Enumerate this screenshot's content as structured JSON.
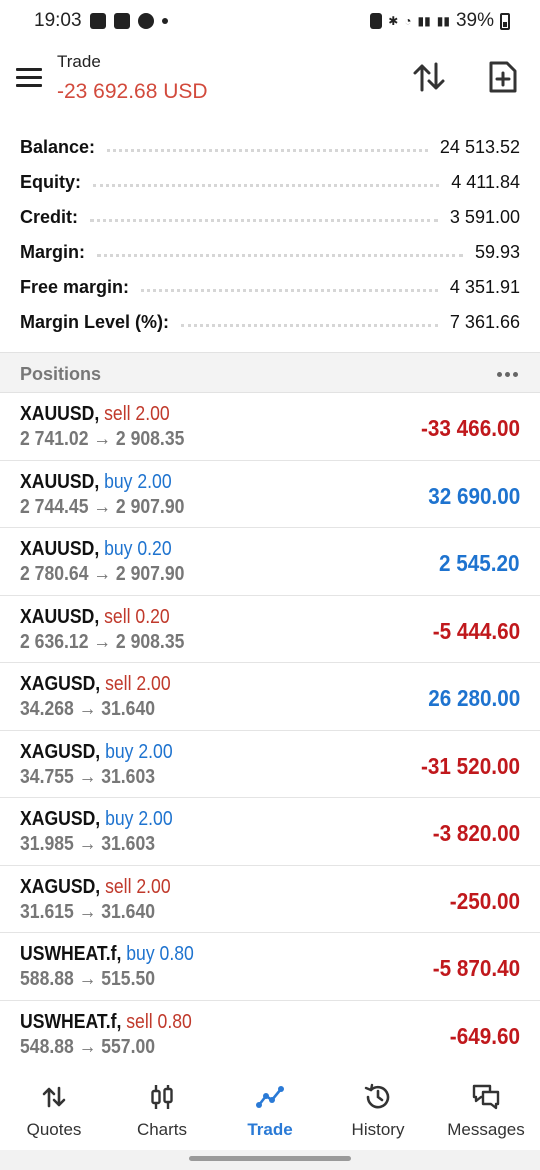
{
  "status_bar": {
    "time": "19:03",
    "battery": "39%"
  },
  "header": {
    "title": "Trade",
    "profit": "-23 692.68 USD"
  },
  "summary": [
    {
      "label": "Balance:",
      "value": "24 513.52"
    },
    {
      "label": "Equity:",
      "value": "4 411.84"
    },
    {
      "label": "Credit:",
      "value": "3 591.00"
    },
    {
      "label": "Margin:",
      "value": "59.93"
    },
    {
      "label": "Free margin:",
      "value": "4 351.91"
    },
    {
      "label": "Margin Level (%):",
      "value": "7 361.66"
    }
  ],
  "positions_title": "Positions",
  "positions": [
    {
      "symbol": "XAUUSD,",
      "side": "sell 2.00",
      "prices": "2 741.02 → 2 908.35",
      "profit": "-33 466.00"
    },
    {
      "symbol": "XAUUSD,",
      "side": "buy 2.00",
      "prices": "2 744.45 → 2 907.90",
      "profit": "32 690.00"
    },
    {
      "symbol": "XAUUSD,",
      "side": "buy 0.20",
      "prices": "2 780.64 → 2 907.90",
      "profit": "2 545.20"
    },
    {
      "symbol": "XAUUSD,",
      "side": "sell 0.20",
      "prices": "2 636.12 → 2 908.35",
      "profit": "-5 444.60"
    },
    {
      "symbol": "XAGUSD,",
      "side": "sell 2.00",
      "prices": "34.268 → 31.640",
      "profit": "26 280.00"
    },
    {
      "symbol": "XAGUSD,",
      "side": "buy 2.00",
      "prices": "34.755 → 31.603",
      "profit": "-31 520.00"
    },
    {
      "symbol": "XAGUSD,",
      "side": "buy 2.00",
      "prices": "31.985 → 31.603",
      "profit": "-3 820.00"
    },
    {
      "symbol": "XAGUSD,",
      "side": "sell 2.00",
      "prices": "31.615 → 31.640",
      "profit": "-250.00"
    },
    {
      "symbol": "USWHEAT.f,",
      "side": "buy 0.80",
      "prices": "588.88 → 515.50",
      "profit": "-5 870.40"
    },
    {
      "symbol": "USWHEAT.f,",
      "side": "sell 0.80",
      "prices": "548.88 → 557.00",
      "profit": "-649.60"
    }
  ],
  "nav": [
    {
      "label": "Quotes",
      "icon": "quotes-icon"
    },
    {
      "label": "Charts",
      "icon": "charts-icon"
    },
    {
      "label": "Trade",
      "icon": "trade-icon"
    },
    {
      "label": "History",
      "icon": "history-icon"
    },
    {
      "label": "Messages",
      "icon": "messages-icon"
    }
  ],
  "colors": {
    "loss": "#c0181c",
    "gain": "#1e73cf",
    "header_profit": "#d24a3c",
    "active_nav": "#2a7ad6"
  }
}
